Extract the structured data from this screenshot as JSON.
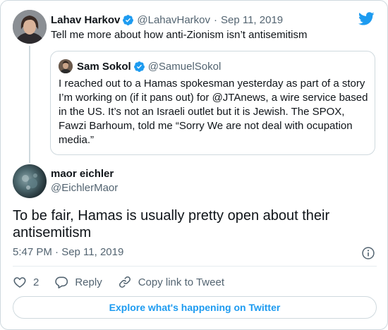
{
  "colors": {
    "accent": "#1d9bf0",
    "text": "#0f1419",
    "secondary": "#536471",
    "border": "#cfd9de"
  },
  "icons": {
    "verified": "verified-badge-icon",
    "brand": "twitter-bird-icon",
    "info": "info-icon",
    "like": "heart-icon",
    "reply": "reply-bubble-icon",
    "link": "link-icon"
  },
  "parent_tweet": {
    "name": "Lahav Harkov",
    "handle": "@LahavHarkov",
    "separator": "·",
    "date": "Sep 11, 2019",
    "text": "Tell me more about how anti-Zionism isn’t antisemitism"
  },
  "quoted_tweet": {
    "name": "Sam Sokol",
    "handle": "@SamuelSokol",
    "text": "I reached out to a Hamas spokesman yesterday as part of a story I’m working on (if it pans out) for @JTAnews, a wire service based in the US. It’s not an Israeli outlet but it is Jewish. The SPOX, Fawzi Barhoum, told me “Sorry We are not deal with ocupation media.”"
  },
  "main_tweet": {
    "name": "maor eichler",
    "handle": "@EichlerMaor",
    "text": "To be fair, Hamas is usually pretty open about their antisemitism",
    "timestamp": "5:47 PM · Sep 11, 2019"
  },
  "actions": {
    "like_count": "2",
    "reply_label": "Reply",
    "copy_link_label": "Copy link to Tweet"
  },
  "explore_label": "Explore what's happening on Twitter"
}
